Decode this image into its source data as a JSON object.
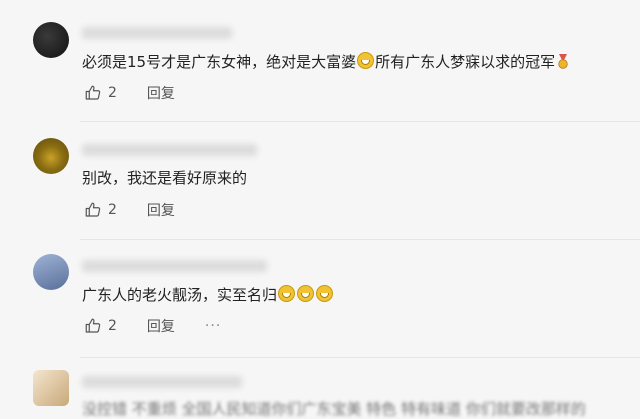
{
  "comments": [
    {
      "text_before": "必须是15号才是广东女神，绝对是大富婆",
      "text_after": "所有广东人梦寐以求的冠军",
      "likes": "2",
      "reply_label": "回复"
    },
    {
      "text": "别改，我还是看好原来的",
      "likes": "2",
      "reply_label": "回复"
    },
    {
      "text": "广东人的老火靓汤，实至名归",
      "likes": "2",
      "reply_label": "回复",
      "more_label": "···"
    }
  ],
  "partial": {
    "text": "没控错 不重烦 全国人民知道你们广东宝美 特色 特有味道 你们就要改那样的"
  },
  "icons": {
    "like": "thumbs-up-icon",
    "emoji": "grinning-face-icon",
    "medal": "medal-icon",
    "more": "more-dots-icon"
  }
}
